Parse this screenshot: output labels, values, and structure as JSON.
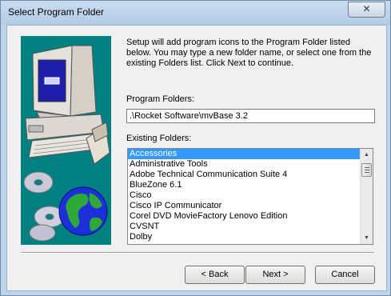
{
  "window": {
    "title": "Select Program Folder",
    "close_glyph": "✕"
  },
  "intro_text": "Setup will add program icons to the Program Folder listed below. You may type a new folder name, or select one from the existing Folders list.  Click Next to continue.",
  "program_folders": {
    "label": "Program Folders:",
    "value": ".\\Rocket Software\\mvBase 3.2"
  },
  "existing_folders": {
    "label": "Existing Folders:",
    "items": [
      "Accessories",
      "Administrative Tools",
      "Adobe Technical Communication Suite 4",
      "BlueZone 6.1",
      "Cisco",
      "Cisco IP Communicator",
      "Corel DVD MovieFactory Lenovo Edition",
      "CVSNT",
      "Dolby"
    ],
    "selected_index": 0
  },
  "buttons": {
    "back": "< Back",
    "next": "Next >",
    "cancel": "Cancel"
  },
  "icons": {
    "close": "close-icon",
    "scroll_up": "scroll-up-arrow-icon",
    "scroll_down": "scroll-down-arrow-icon",
    "computer": "computer-icon",
    "globe": "globe-icon",
    "cd": "cd-icon"
  },
  "colors": {
    "selection": "#3399ff",
    "art_background": "#008080",
    "titlebar": "#bcd3ea"
  }
}
